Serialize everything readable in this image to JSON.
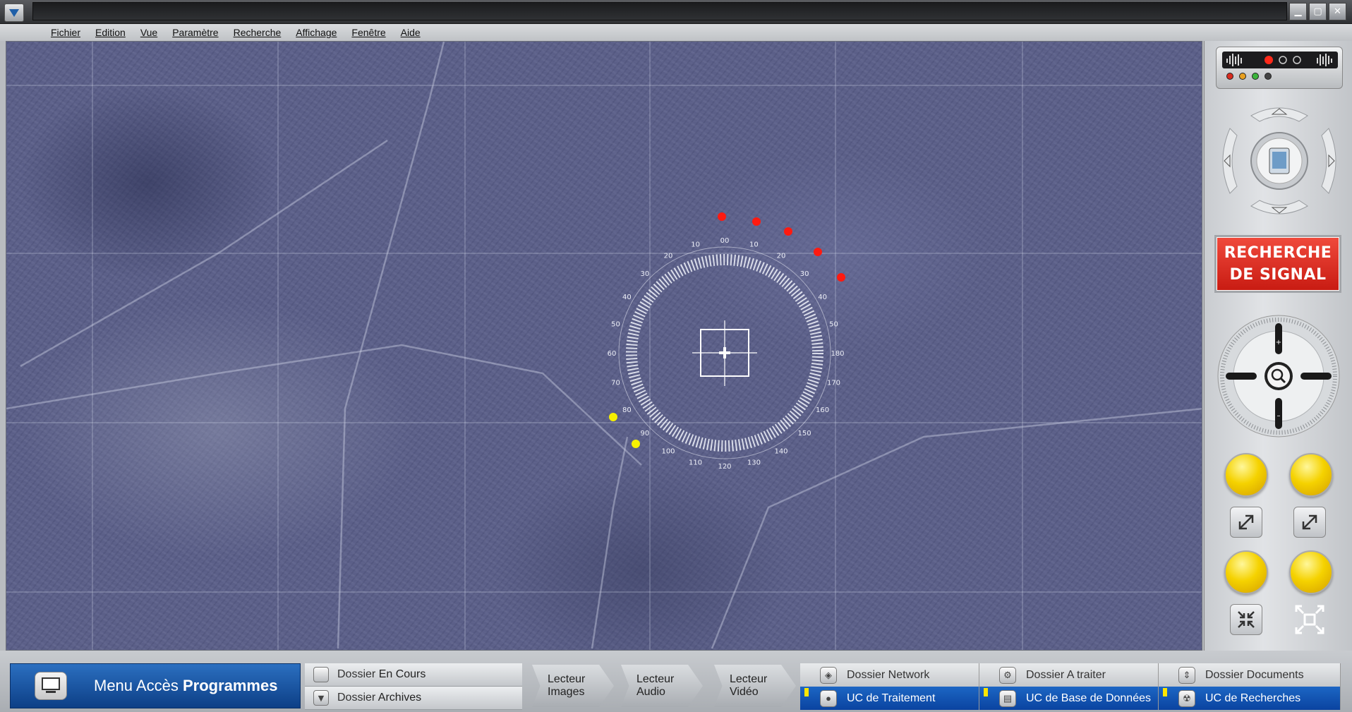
{
  "menu": {
    "items": [
      "Fichier",
      "Edition",
      "Vue",
      "Paramètre",
      "Recherche",
      "Affichage",
      "Fenêtre",
      "Aide"
    ]
  },
  "radar": {
    "scale_labels": [
      "70",
      "60",
      "50",
      "40",
      "30",
      "20",
      "10",
      "00",
      "10",
      "20",
      "30",
      "40",
      "50",
      "180",
      "170",
      "160",
      "150",
      "140",
      "130",
      "120",
      "110",
      "100",
      "90",
      "80"
    ]
  },
  "signal": {
    "line1": "RECHERCHE",
    "line2": "DE SIGNAL"
  },
  "bottom": {
    "program_menu_prefix": "Menu Accès ",
    "program_menu_bold": "Programmes",
    "dossier_en_cours_prefix": "Dossier ",
    "dossier_en_cours_bold": "En Cours",
    "dossier_archives_prefix": "Dossier ",
    "dossier_archives_bold": "Archives",
    "players": [
      {
        "line1": "Lecteur",
        "line2": "Images"
      },
      {
        "line1": "Lecteur",
        "line2": "Audio"
      },
      {
        "line1": "Lecteur",
        "line2": "Vidéo"
      }
    ],
    "network": {
      "top": [
        "Dossier Network",
        "Dossier A traiter",
        "Dossier Documents"
      ],
      "bottom": [
        "UC de Traitement",
        "UC de Base de Données",
        "UC de Recherches"
      ]
    }
  },
  "colors": {
    "accent_blue": "#0d3f86",
    "signal_red": "#d9261b",
    "marker_red": "#ff1a10",
    "marker_yellow": "#f6f000"
  }
}
